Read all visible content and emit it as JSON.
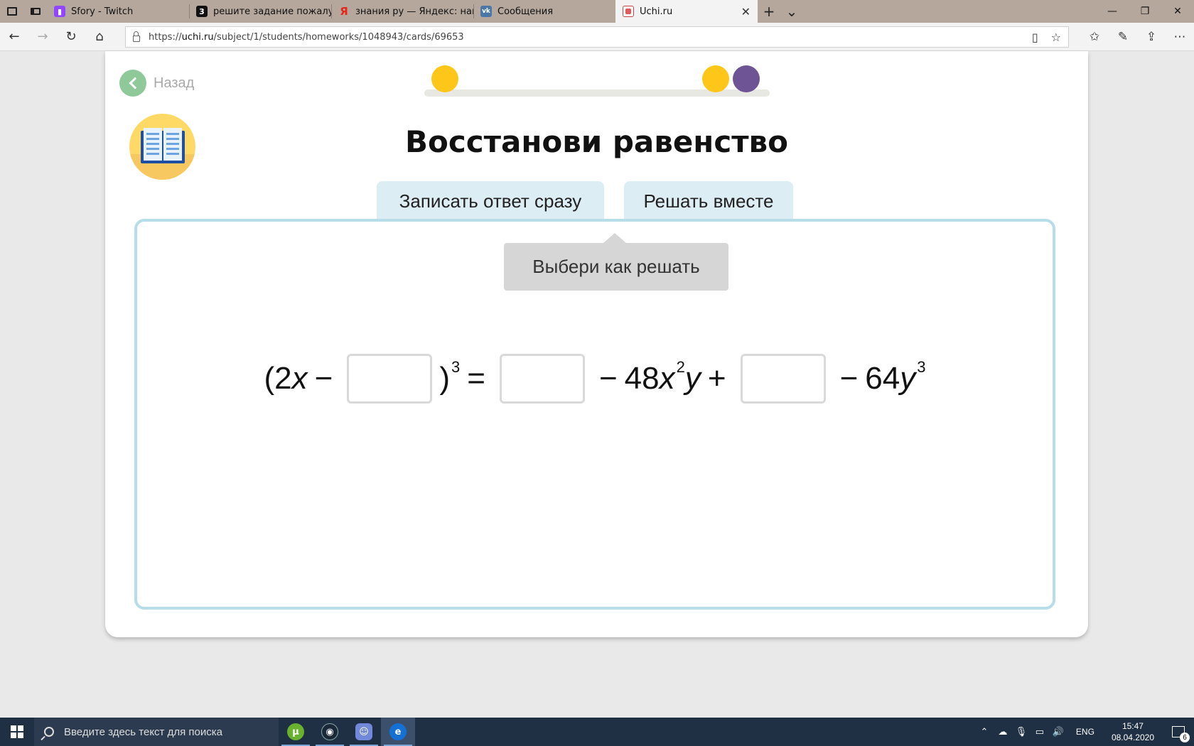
{
  "tabs": [
    {
      "label": "Sfory - Twitch",
      "favicon": "twitch-icon"
    },
    {
      "label": "решите задание пожалуйс",
      "favicon": "znanija-icon"
    },
    {
      "label": "знания ру — Яндекс: нашл",
      "favicon": "yandex-icon"
    },
    {
      "label": "Сообщения",
      "favicon": "vk-icon"
    },
    {
      "label": "Uchi.ru",
      "favicon": "uchi-icon",
      "active": true
    }
  ],
  "address": {
    "prefix": "https://",
    "host": "uchi.ru",
    "path": "/subject/1/students/homeworks/1048943/cards/69653"
  },
  "page": {
    "back_label": "Назад",
    "title": "Восстанови равенство",
    "tab_answer": "Записать ответ сразу",
    "tab_together": "Решать вместе",
    "hint": "Выбери как решать",
    "progress": {
      "dots": [
        {
          "color": "#ffc61a",
          "position": 0.06
        },
        {
          "color": "#ffc61a",
          "position": 0.84
        },
        {
          "color": "#6e5494",
          "position": 0.93
        }
      ]
    },
    "equation": {
      "open_paren": "(",
      "coef_2": "2",
      "var_x": "x",
      "minus1": "−",
      "close_paren": ")",
      "pow3": "3",
      "equals": "=",
      "minus2": "−",
      "term_48": "48",
      "var_x2": "x",
      "pow2": "2",
      "var_y": "y",
      "plus": "+",
      "minus3": "−",
      "term_64": "64",
      "var_y3": "y",
      "pow3b": "3"
    }
  },
  "taskbar": {
    "search_placeholder": "Введите здесь текст для поиска",
    "lang": "ENG",
    "time": "15:47",
    "date": "08.04.2020",
    "notifications": "6"
  },
  "colors": {
    "accent_yellow": "#ffc61a",
    "accent_purple": "#6e5494",
    "back_green": "#8fc99a",
    "task_border": "#b7dde9"
  }
}
